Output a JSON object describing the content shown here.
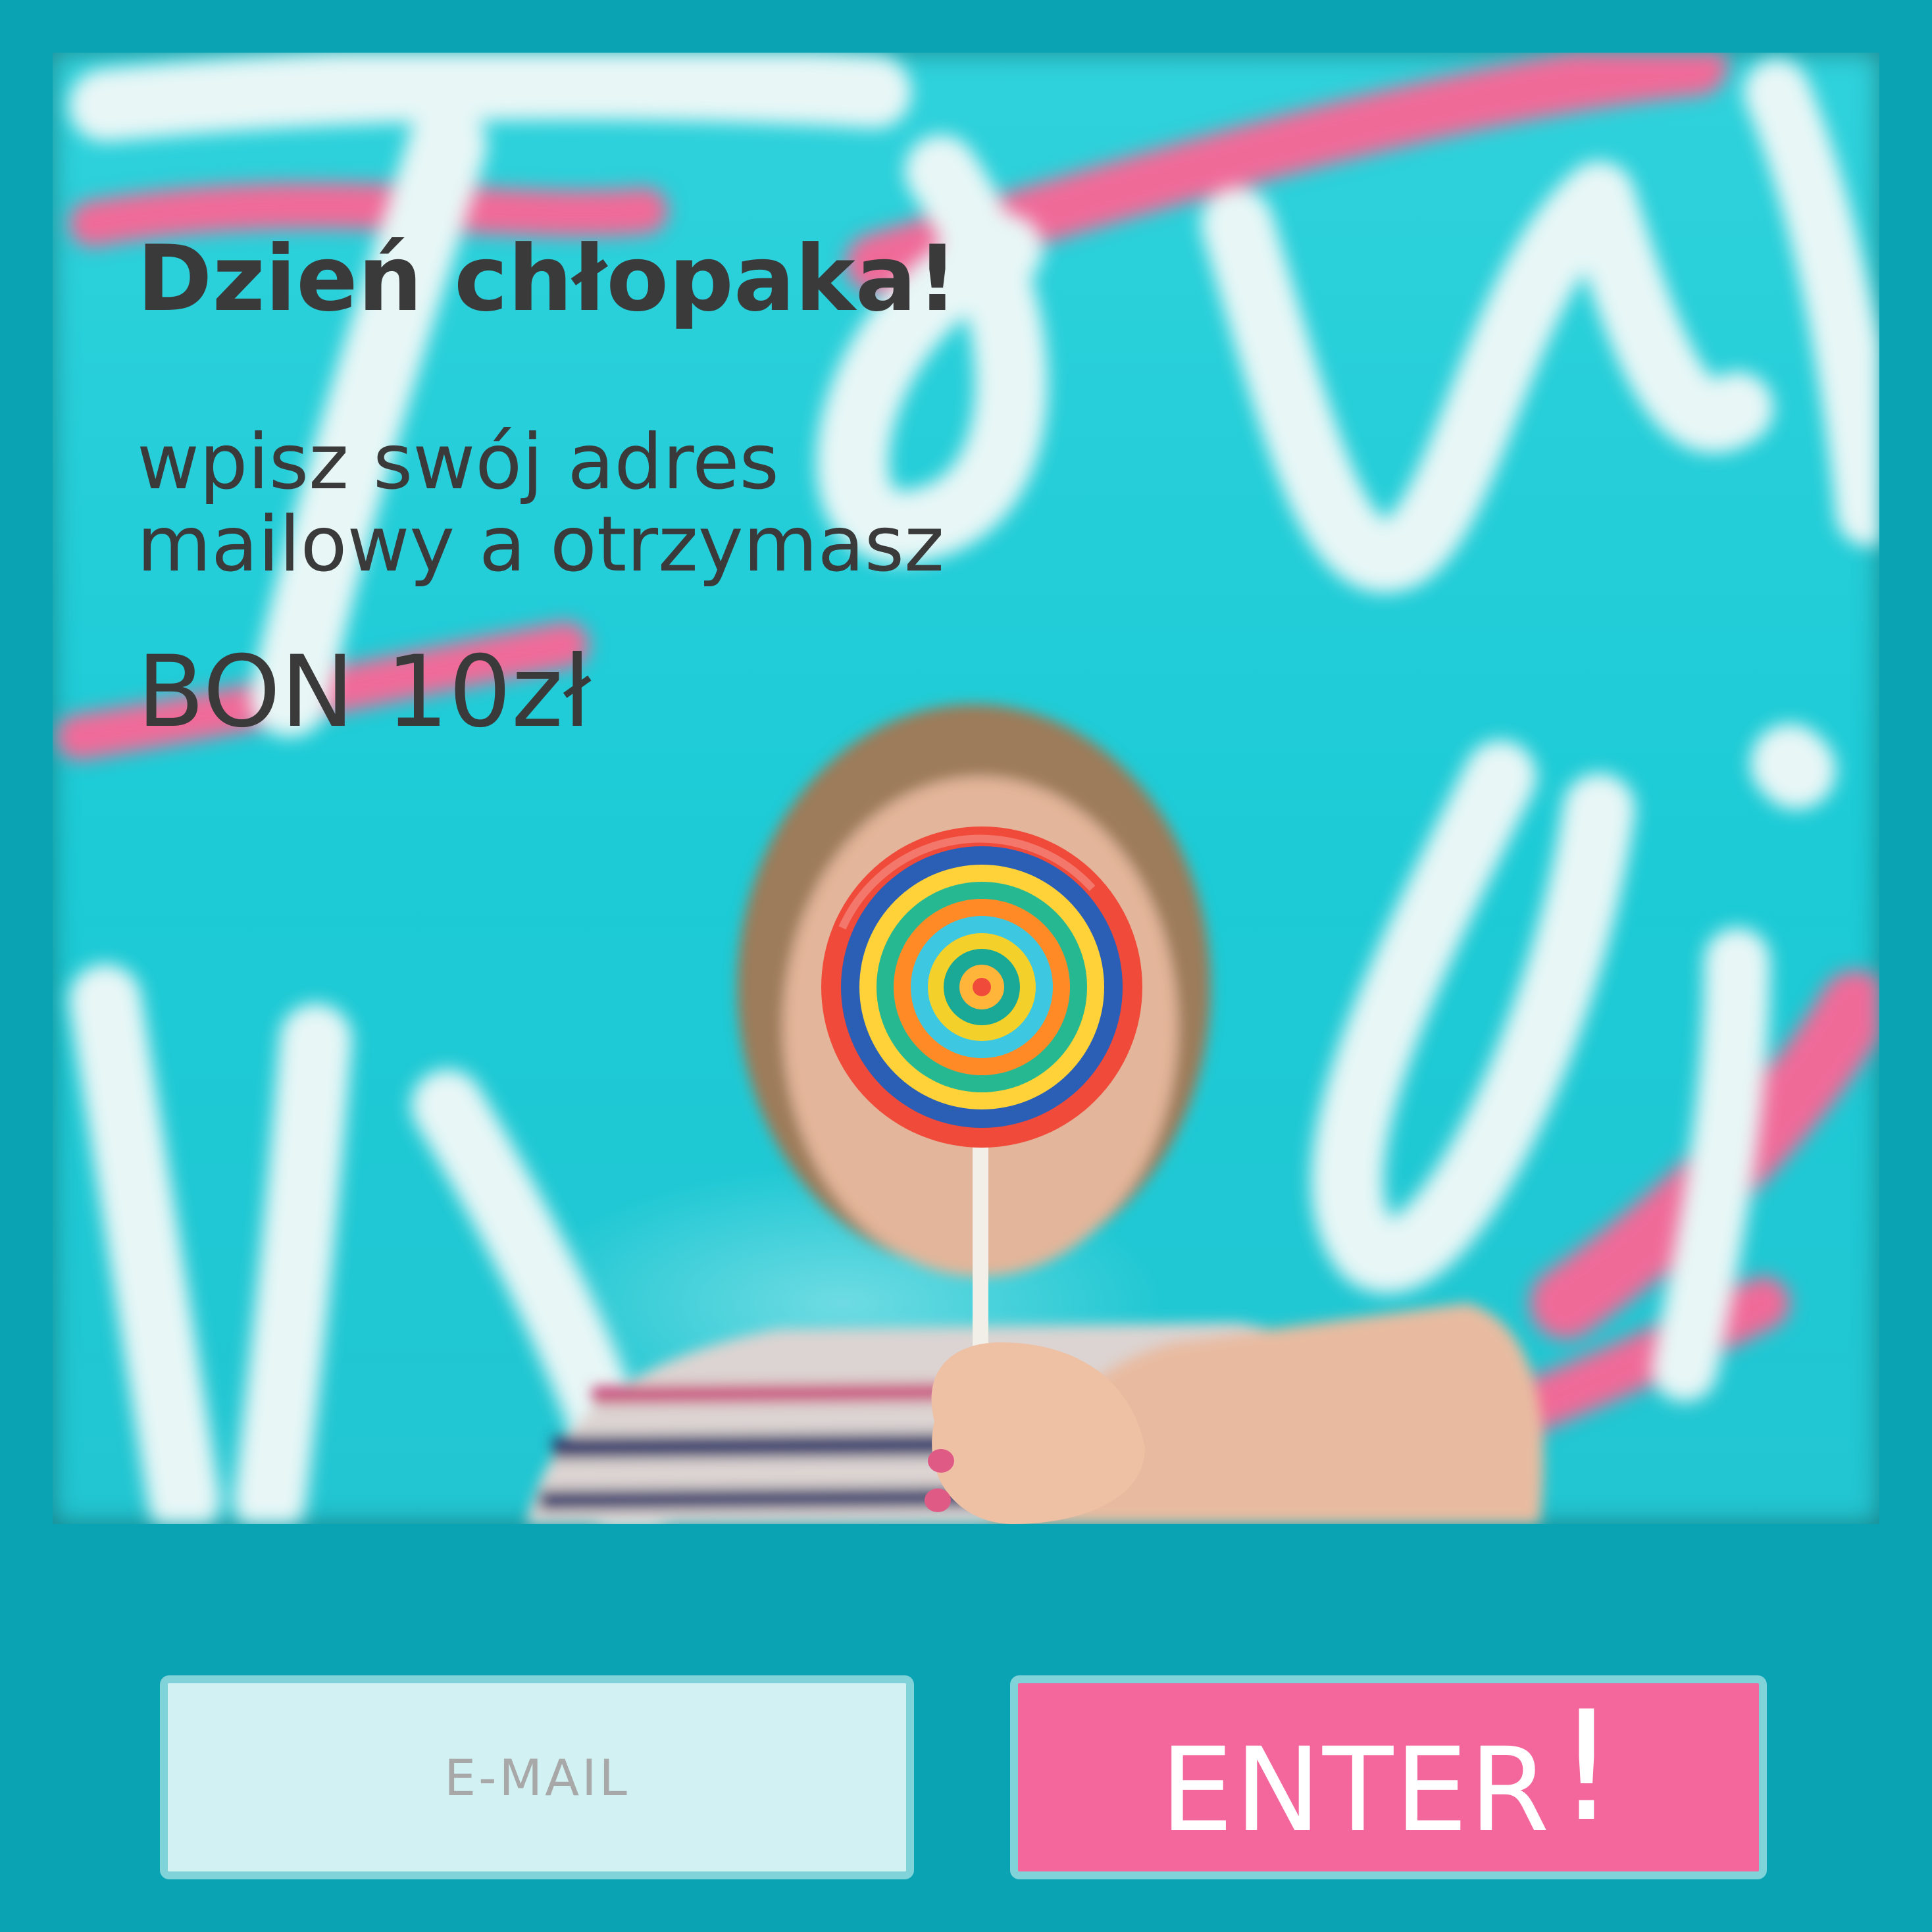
{
  "promo": {
    "headline": "Dzień chłopaka!",
    "subline_1": "wpisz swój adres",
    "subline_2": "mailowy a otrzymasz",
    "voucher": "BON 10zł"
  },
  "form": {
    "email_placeholder": "E-MAIL",
    "enter_label": "ENTER",
    "enter_exclaim": "!"
  },
  "colors": {
    "frame_bg": "#0aa3b3",
    "photo_bg": "#1ccbd6",
    "text": "#3a3a3a",
    "email_bg": "#d2f1f3",
    "button_bg": "#f4679c",
    "border": "#7fd3d9"
  }
}
